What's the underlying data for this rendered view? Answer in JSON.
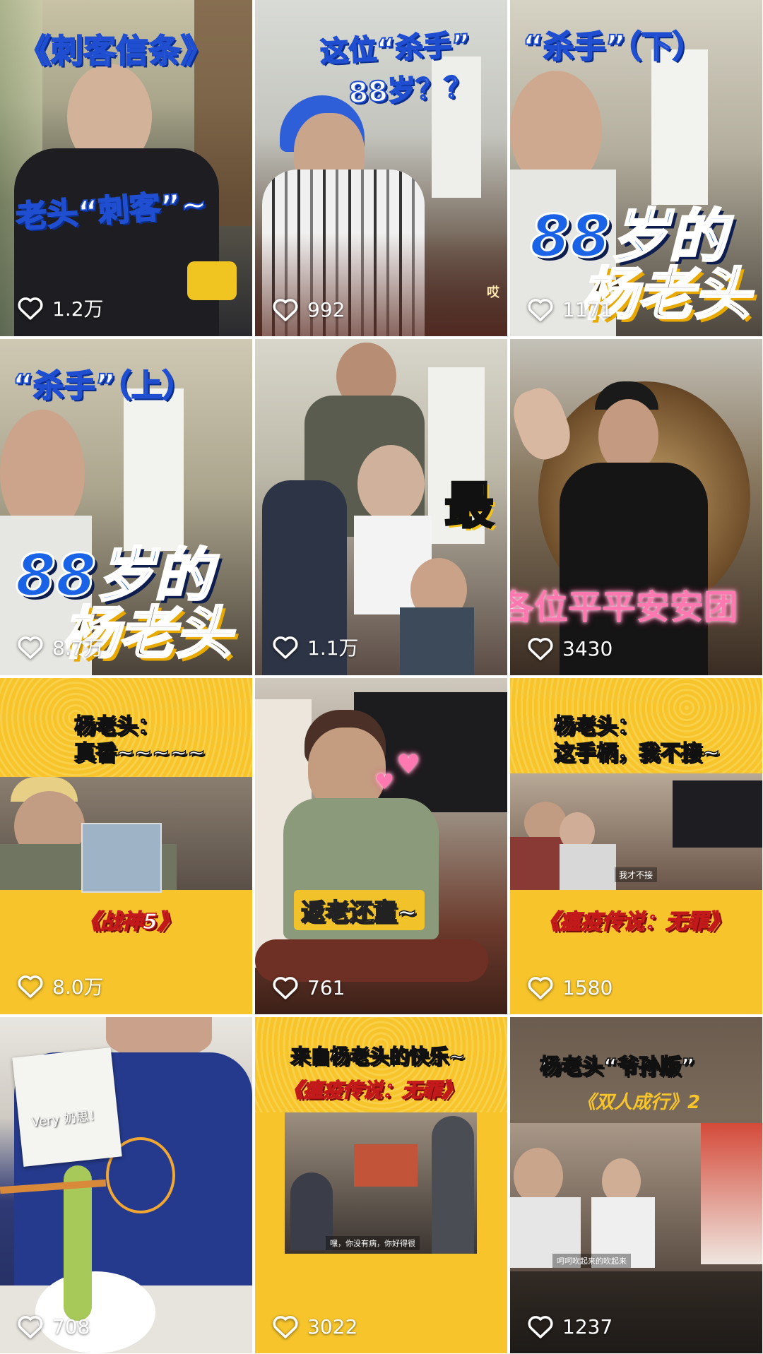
{
  "tiles": [
    {
      "likes": "1.2万",
      "captions": [
        "《刺客信条》",
        "老头“刺客”~"
      ]
    },
    {
      "likes": "992",
      "captions": [
        "这位“杀手”",
        "88岁？？",
        "哎"
      ]
    },
    {
      "likes": "1171",
      "captions": [
        "“杀手”（下）",
        "88岁的",
        "杨老头"
      ]
    },
    {
      "likes": "8.7万",
      "captions": [
        "“杀手”（上）",
        "88岁的",
        "杨老头"
      ]
    },
    {
      "likes": "1.1万",
      "captions": [
        "最"
      ]
    },
    {
      "likes": "3430",
      "captions": [
        "各位平平安安团"
      ]
    },
    {
      "likes": "8.0万",
      "captions": [
        "杨老头：",
        "真香~~~~~",
        "《战神5》"
      ]
    },
    {
      "likes": "761",
      "captions": [
        "返老还童~"
      ]
    },
    {
      "likes": "1580",
      "captions": [
        "杨老头：",
        "这手柄，我不接~",
        "《瘟疫传说：无罪》",
        "我才不接"
      ]
    },
    {
      "likes": "708",
      "captions": [
        "Very 奶思！"
      ]
    },
    {
      "likes": "3022",
      "captions": [
        "来自杨老头的快乐~",
        "《瘟疫传说：无罪》",
        "嘿，你没有病，你好得很"
      ]
    },
    {
      "likes": "1237",
      "captions": [
        "杨老头“爷孙版”",
        "《双人成行》2",
        "呵呵吹起来的吹起来"
      ]
    }
  ],
  "icons": {
    "like": "heart-outline-icon"
  },
  "colors": {
    "accent_yellow": "#f7c52b",
    "caption_blue": "#1a63e6",
    "text_white": "#ffffff"
  }
}
